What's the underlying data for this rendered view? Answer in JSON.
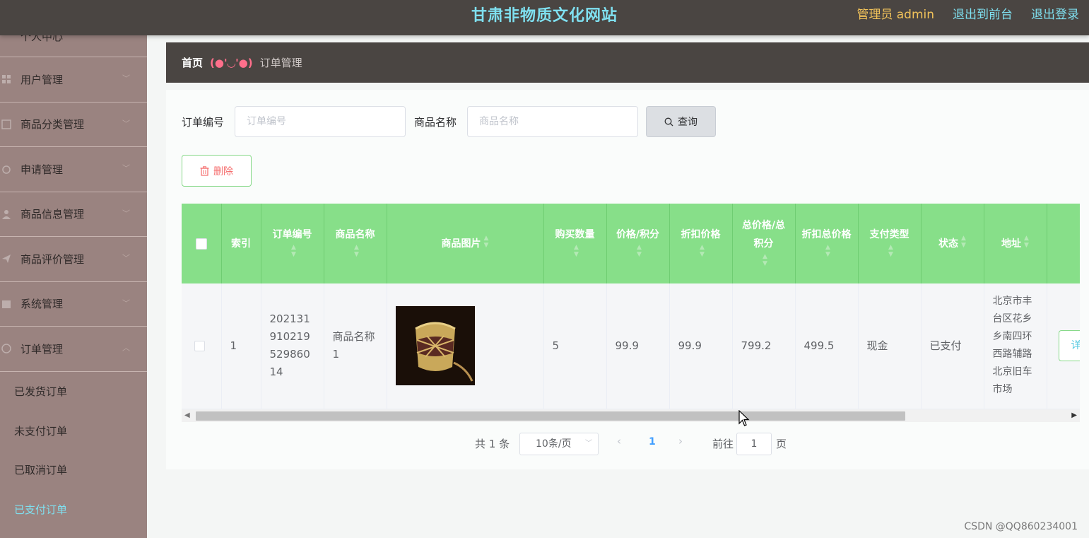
{
  "header": {
    "site_title": "甘肃非物质文化网站",
    "admin_label": "管理员 admin",
    "to_front": "退出到前台",
    "logout": "退出登录"
  },
  "sidebar": {
    "items": [
      {
        "label": "个人中心"
      },
      {
        "label": "用户管理"
      },
      {
        "label": "商品分类管理"
      },
      {
        "label": "申请管理"
      },
      {
        "label": "商品信息管理"
      },
      {
        "label": "商品评价管理"
      },
      {
        "label": "系统管理"
      },
      {
        "label": "订单管理"
      }
    ],
    "sub_items": [
      {
        "label": "已发货订单"
      },
      {
        "label": "未支付订单"
      },
      {
        "label": "已取消订单"
      },
      {
        "label": "已支付订单"
      }
    ]
  },
  "breadcrumb": {
    "home": "首页",
    "face": "(●'◡'●)",
    "current": "订单管理"
  },
  "search": {
    "order_no_label": "订单编号",
    "order_no_placeholder": "订单编号",
    "product_name_label": "商品名称",
    "product_name_placeholder": "商品名称",
    "query_button": "查询",
    "delete_button": "删除"
  },
  "table": {
    "columns": [
      "索引",
      "订单编号",
      "商品名称",
      "商品图片",
      "购买数量",
      "价格/积分",
      "折扣价格",
      "总价格/总积分",
      "折扣总价格",
      "支付类型",
      "状态",
      "地址"
    ],
    "rows": [
      {
        "index": "1",
        "order_no": "20213191021952986014",
        "product_name": "商品名称1",
        "quantity": "5",
        "price": "99.9",
        "discount_price": "99.9",
        "total_price": "799.2",
        "discount_total": "499.5",
        "pay_type": "现金",
        "status": "已支付",
        "address": "北京市丰台区花乡乡南四环西路辅路北京旧车市场",
        "detail_button": "详"
      }
    ]
  },
  "pagination": {
    "total": "共 1 条",
    "page_size": "10条/页",
    "current_page": "1",
    "goto_label": "前往",
    "goto_value": "1",
    "page_label": "页"
  },
  "watermark": "CSDN @QQ860234001",
  "colors": {
    "topbar": "#4a4542",
    "sidebar": "#9a8380",
    "table_header": "#87df89",
    "accent_cyan": "#7fe0f0",
    "admin_gold": "#f2c35a"
  }
}
